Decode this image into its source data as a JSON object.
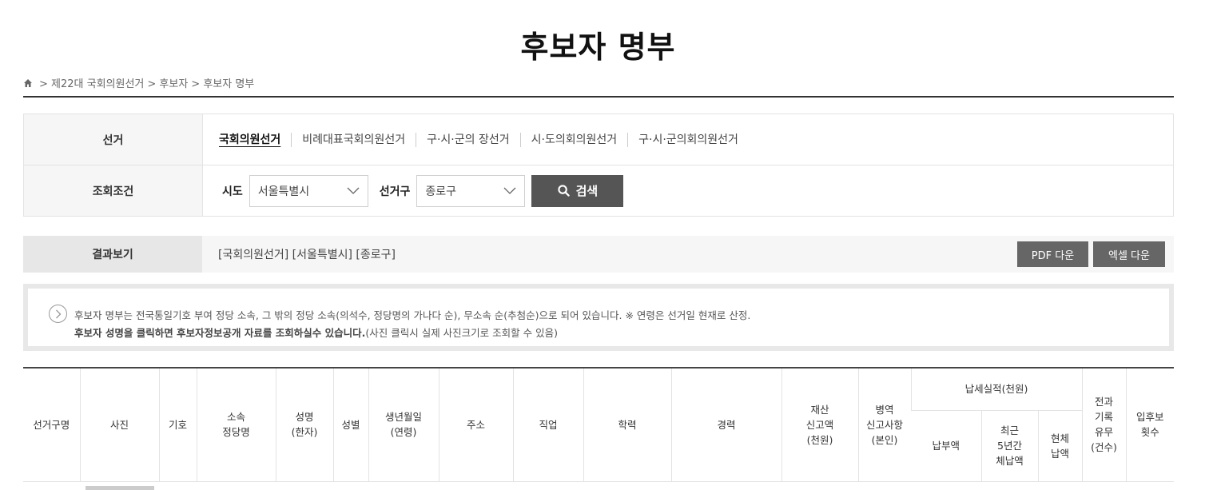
{
  "page_title": "후보자 명부",
  "breadcrumb": {
    "home_icon": "home-icon",
    "items": [
      "> 제22대 국회의원선거",
      "> 후보자",
      "> 후보자 명부"
    ]
  },
  "filter": {
    "election_label": "선거",
    "election_tabs": [
      "국회의원선거",
      "비례대표국회의원선거",
      "구·시·군의 장선거",
      "시·도의회의원선거",
      "구·시·군의회의원선거"
    ],
    "active_tab": 0,
    "query_label": "조회조건",
    "sido_label": "시도",
    "sido_value": "서울특별시",
    "district_label": "선거구",
    "district_value": "종로구",
    "search_label": "검색"
  },
  "result": {
    "label": "결과보기",
    "summary": "[국회의원선거] [서울특별시] [종로구]",
    "pdf_label": "PDF 다운",
    "excel_label": "엑셀 다운"
  },
  "notice": {
    "line1": "후보자 명부는 전국통일기호 부여 정당 소속, 그 밖의 정당 소속(의석수, 정당명의 가나다 순), 무소속 순(추첨순)으로 되어 있습니다. ※ 연령은 선거일 현재로 산정.",
    "line2_bold": "후보자 성명을 클릭하면 후보자정보공개 자료를 조회하실수 있습니다.",
    "line2_rest": "(사진 클릭시 실제 사진크기로 조회할 수 있음)"
  },
  "table": {
    "col_district": "선거구명",
    "col_photo": "사진",
    "col_number": "기호",
    "col_party": "소속\n정당명",
    "col_name": "성명\n(한자)",
    "col_gender": "성별",
    "col_birth": "생년월일\n(연령)",
    "col_address": "주소",
    "col_job": "직업",
    "col_education": "학력",
    "col_career": "경력",
    "col_assets": "재산\n신고액\n(천원)",
    "col_military": "병역\n신고사항\n(본인)",
    "col_tax_group": "납세실적(천원)",
    "col_tax_paid": "납부액",
    "col_tax_arrears5": "최근\n5년간\n체납액",
    "col_tax_current": "현체\n납액",
    "col_criminal": "전과\n기록\n유무\n(건수)",
    "col_runs": "입후보\n횟수"
  }
}
